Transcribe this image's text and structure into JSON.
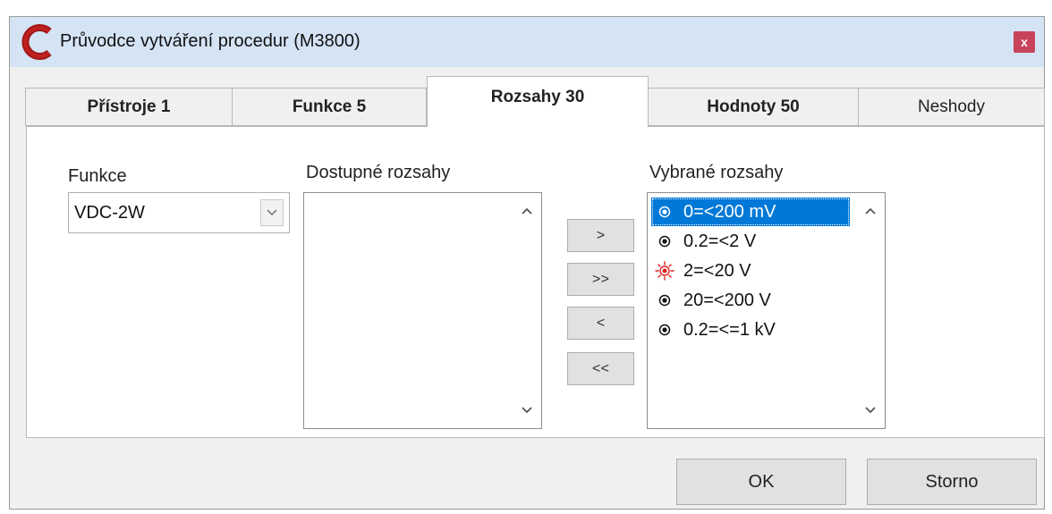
{
  "window": {
    "title": "Průvodce vytváření procedur (M3800)",
    "close_label": "x",
    "accent_color": "#c7435a"
  },
  "tabs": [
    {
      "label": "Přístroje 1"
    },
    {
      "label": "Funkce 5"
    },
    {
      "label": "Rozsahy 30",
      "active": true
    },
    {
      "label": "Hodnoty 50"
    },
    {
      "label": "Neshody"
    }
  ],
  "function_select": {
    "label": "Funkce",
    "value": "VDC-2W"
  },
  "available": {
    "label": "Dostupné rozsahy",
    "items": []
  },
  "buttons": {
    "add": ">",
    "add_all": ">>",
    "remove": "<",
    "remove_all": "<<"
  },
  "selected": {
    "label": "Vybrané rozsahy",
    "items": [
      {
        "text": "0=<200 mV",
        "icon": "radio-dot-icon",
        "selected": true
      },
      {
        "text": "0.2=<2 V",
        "icon": "radio-dot-icon"
      },
      {
        "text": "2=<20 V",
        "icon": "warning-sun-icon"
      },
      {
        "text": "20=<200 V",
        "icon": "radio-dot-icon"
      },
      {
        "text": "0.2=<=1 kV",
        "icon": "radio-dot-icon"
      }
    ]
  },
  "footer": {
    "ok": "OK",
    "cancel": "Storno"
  }
}
